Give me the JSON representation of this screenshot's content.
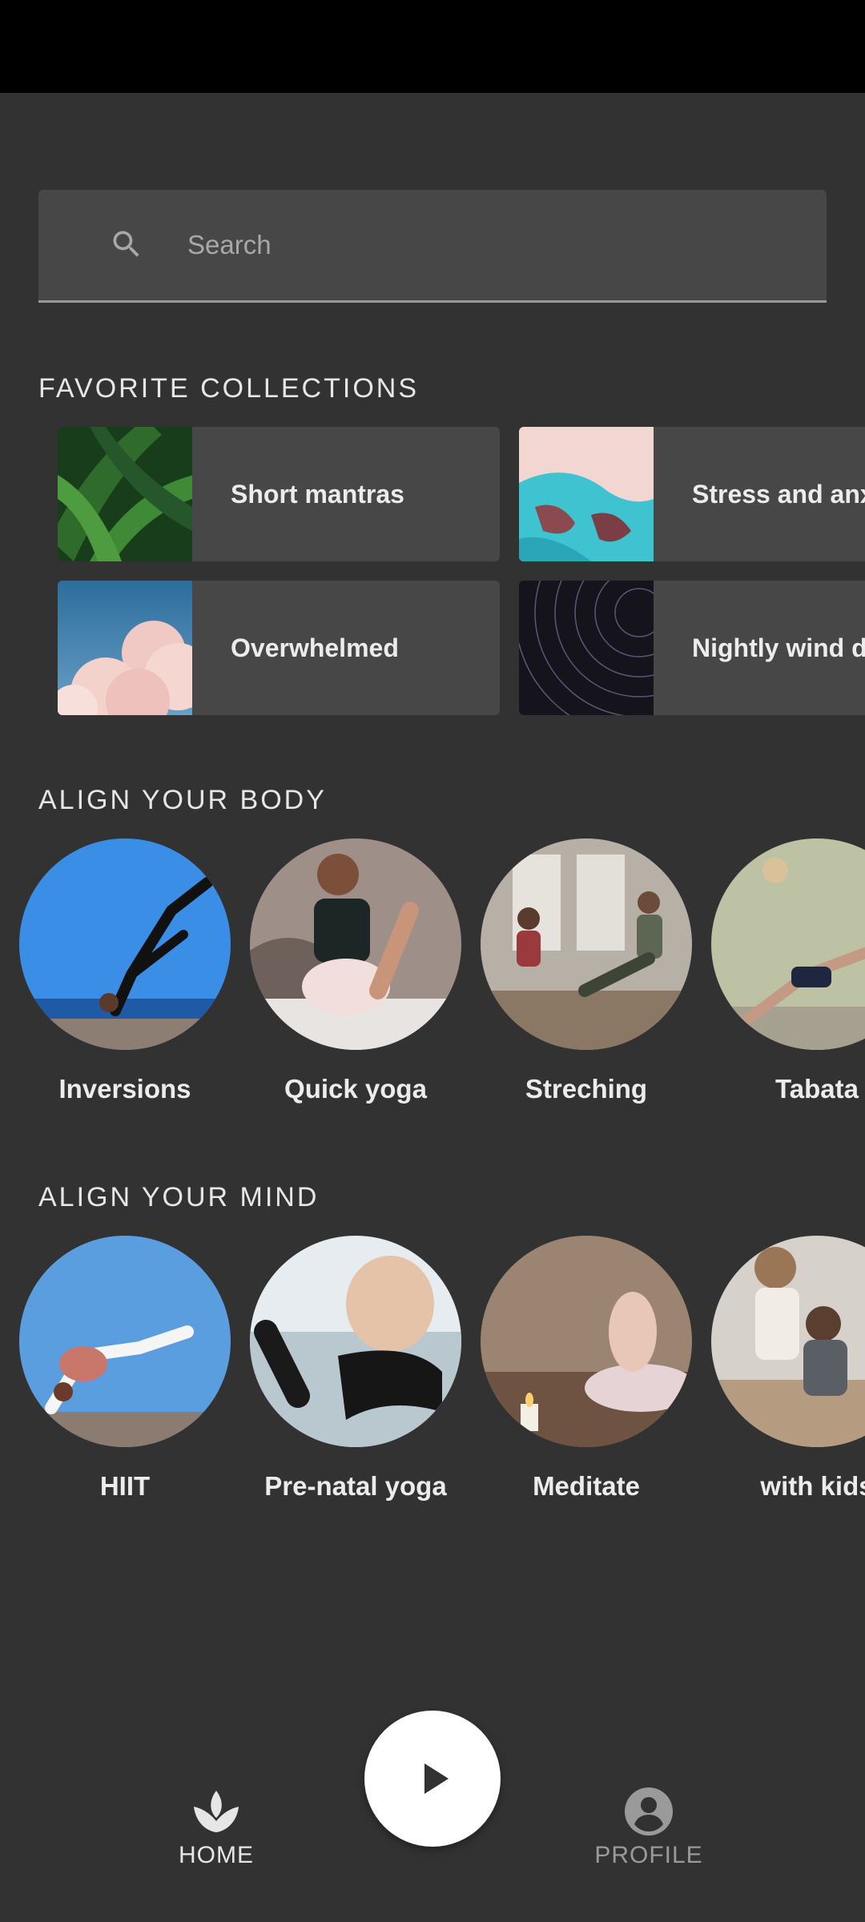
{
  "search": {
    "placeholder": "Search"
  },
  "sections": {
    "favorites_title": "FAVORITE COLLECTIONS",
    "body_title": "ALIGN YOUR BODY",
    "mind_title": "ALIGN YOUR MIND"
  },
  "favorites": [
    {
      "label": "Short mantras"
    },
    {
      "label": "Stress and anxiety"
    },
    {
      "label": "Overwhelmed"
    },
    {
      "label": "Nightly wind down"
    }
  ],
  "align_body": [
    {
      "label": "Inversions"
    },
    {
      "label": "Quick yoga"
    },
    {
      "label": "Streching"
    },
    {
      "label": "Tabata"
    }
  ],
  "align_mind": [
    {
      "label": "HIIT"
    },
    {
      "label": "Pre-natal yoga"
    },
    {
      "label": "Meditate"
    },
    {
      "label": "with kids"
    }
  ],
  "nav": {
    "home_label": "HOME",
    "profile_label": "PROFILE",
    "play_icon": "play-icon",
    "home_icon": "spa-icon",
    "profile_icon": "account-circle-icon"
  },
  "colors": {
    "background": "#323232",
    "surface": "#474747",
    "status_bar": "#000000",
    "fab": "#ffffff"
  }
}
